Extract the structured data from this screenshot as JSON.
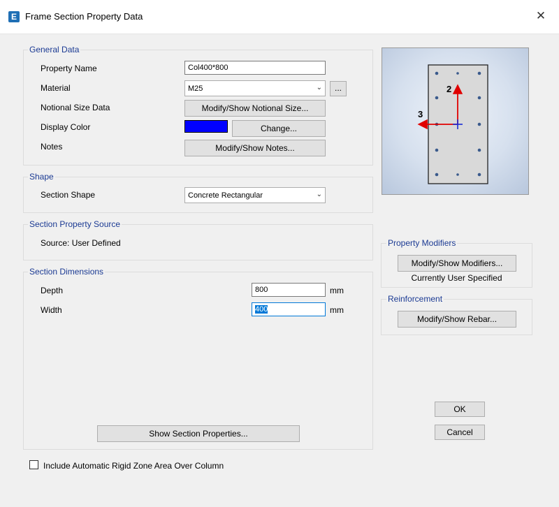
{
  "window": {
    "title": "Frame Section Property Data",
    "app_icon": "E",
    "close_glyph": "✕"
  },
  "general_data": {
    "heading": "General Data",
    "property_name_label": "Property Name",
    "property_name_value": "Col400*800",
    "material_label": "Material",
    "material_value": "M25",
    "material_ellipsis": "...",
    "notional_label": "Notional Size Data",
    "notional_button": "Modify/Show Notional Size...",
    "display_color_label": "Display Color",
    "display_color_value": "#0000ff",
    "change_button": "Change...",
    "notes_label": "Notes",
    "notes_button": "Modify/Show Notes..."
  },
  "shape": {
    "heading": "Shape",
    "section_shape_label": "Section Shape",
    "section_shape_value": "Concrete Rectangular"
  },
  "property_source": {
    "heading": "Section Property Source",
    "source_text": "Source:  User Defined"
  },
  "dimensions": {
    "heading": "Section Dimensions",
    "depth_label": "Depth",
    "depth_value": "800",
    "depth_unit": "mm",
    "width_label": "Width",
    "width_value": "400",
    "width_unit": "mm",
    "show_properties_button": "Show Section Properties..."
  },
  "preview": {
    "axis2_label": "2",
    "axis3_label": "3",
    "axis2_color": "#e00000",
    "axis3_color": "#e00000",
    "centroid_color": "#1a2bd6",
    "section_fill": "#d9d9d9",
    "rebar_color": "#3a5a8c"
  },
  "property_modifiers": {
    "heading": "Property Modifiers",
    "button": "Modify/Show Modifiers...",
    "status": "Currently User Specified"
  },
  "reinforcement": {
    "heading": "Reinforcement",
    "button": "Modify/Show Rebar..."
  },
  "actions": {
    "ok": "OK",
    "cancel": "Cancel"
  },
  "rigid_zone": {
    "checked": false,
    "label": "Include Automatic Rigid Zone Area Over Column"
  }
}
